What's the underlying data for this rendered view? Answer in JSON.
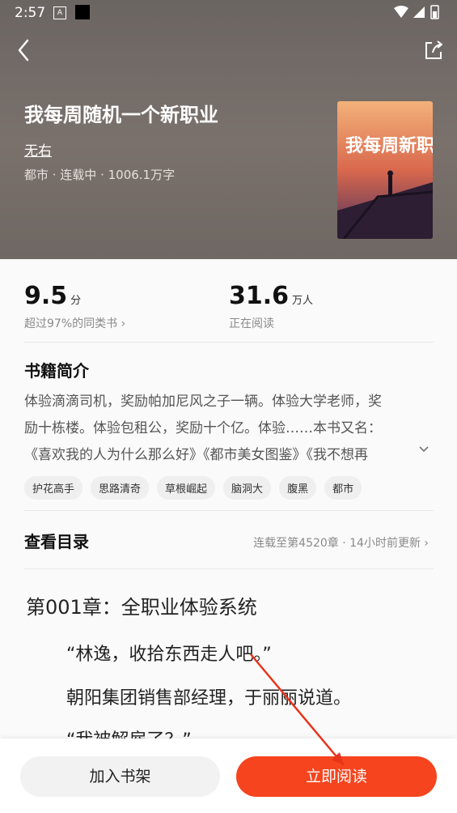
{
  "status_bar": {
    "time": "2:57",
    "a_icon": "A"
  },
  "book": {
    "title": "我每周随机一个新职业",
    "author": "无右",
    "meta": "都市 · 连载中 · 1006.1万字",
    "cover_title": "我每周新职业"
  },
  "stats": {
    "score": "9.5",
    "score_unit": "分",
    "score_sub": "超过97%的同类书 ›",
    "readers": "31.6",
    "readers_unit": "万人",
    "readers_sub": "正在阅读"
  },
  "intro": {
    "heading": "书籍简介",
    "lines": [
      "体验滴滴司机，奖励帕加尼风之子一辆。体验大学老师，奖",
      "励十栋楼。体验包租公，奖励十个亿。体验……本书又名：",
      "《喜欢我的人为什么那么好》《都市美女图鉴》《我不想再"
    ],
    "expand_icon": "chevron-down-icon"
  },
  "tags": [
    "护花高手",
    "思路清奇",
    "草根崛起",
    "脑洞大",
    "腹黑",
    "都市"
  ],
  "toc": {
    "heading": "查看目录",
    "update": "连载至第4520章 · 14小时前更新 ›"
  },
  "preview": {
    "chapter": "第001章：全职业体验系统",
    "paragraphs": [
      "“林逸，收拾东西走人吧。”",
      "朝阳集团销售部经理，于丽丽说道。",
      "“我被解雇了？”"
    ]
  },
  "actions": {
    "add_shelf": "加入书架",
    "read_now": "立即阅读"
  },
  "colors": {
    "accent": "#f5441e",
    "hero_bg": "#736b67"
  }
}
